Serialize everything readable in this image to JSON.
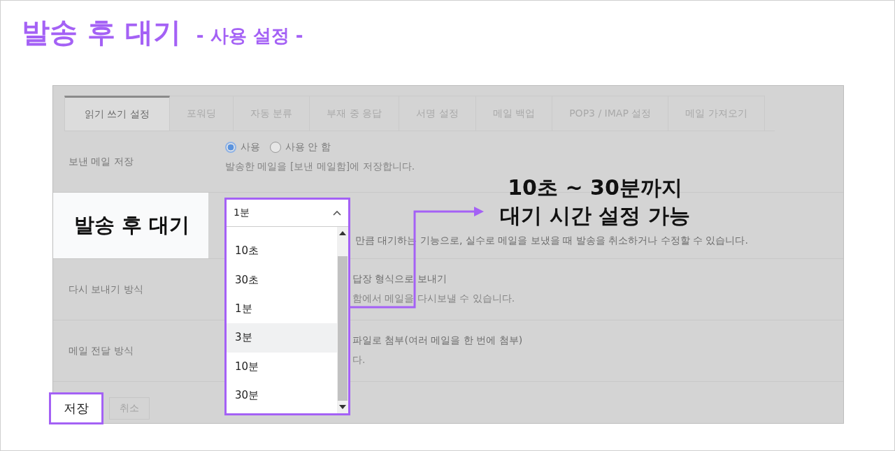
{
  "title": "발송 후 대기",
  "subtitle": "- 사용 설정 -",
  "tabs": [
    {
      "label": "읽기 쓰기 설정",
      "selected": true
    },
    {
      "label": "포워딩",
      "selected": false
    },
    {
      "label": "자동 분류",
      "selected": false
    },
    {
      "label": "부재 중 응답",
      "selected": false
    },
    {
      "label": "서명 설정",
      "selected": false
    },
    {
      "label": "메일 백업",
      "selected": false
    },
    {
      "label": "POP3 / IMAP 설정",
      "selected": false
    },
    {
      "label": "메일 가져오기",
      "selected": false
    }
  ],
  "rows": [
    {
      "label": "보낸 메일 저장",
      "highlighted": false,
      "covered": false,
      "radios": [
        {
          "label": "사용",
          "selected": true
        },
        {
          "label": "사용 안 함",
          "selected": false
        }
      ],
      "lines": [
        "발송한 메일을 [보낸 메일함]에 저장합니다."
      ]
    },
    {
      "label": "발송 후 대기",
      "highlighted": true,
      "covered": true,
      "lines": [
        "만큼 대기하는 기능으로, 실수로 메일을 보냈을 때 발송을 취소하거나 수정할 수 있습니다."
      ]
    },
    {
      "label": "다시 보내기 방식",
      "highlighted": false,
      "covered": true,
      "lines": [
        "답장 형식으로 보내기",
        "함에서 메일을 다시보낼 수 있습니다."
      ]
    },
    {
      "label": "메일 전달 방식",
      "highlighted": false,
      "covered": true,
      "lines": [
        "파일로 첨부(여러 메일을 한 번에 첨부)",
        "다."
      ]
    }
  ],
  "dropdown": {
    "value": "1분",
    "options": [
      {
        "label": "10초",
        "hovered": false
      },
      {
        "label": "30초",
        "hovered": false
      },
      {
        "label": "1분",
        "hovered": false
      },
      {
        "label": "3분",
        "hovered": true
      },
      {
        "label": "10분",
        "hovered": false
      },
      {
        "label": "30분",
        "hovered": false
      }
    ]
  },
  "annotation": [
    "10초 ~ 30분까지",
    "대기 시간 설정 가능"
  ],
  "buttons": [
    {
      "label": "저장",
      "highlighted": true
    },
    {
      "label": "취소",
      "highlighted": false
    }
  ]
}
